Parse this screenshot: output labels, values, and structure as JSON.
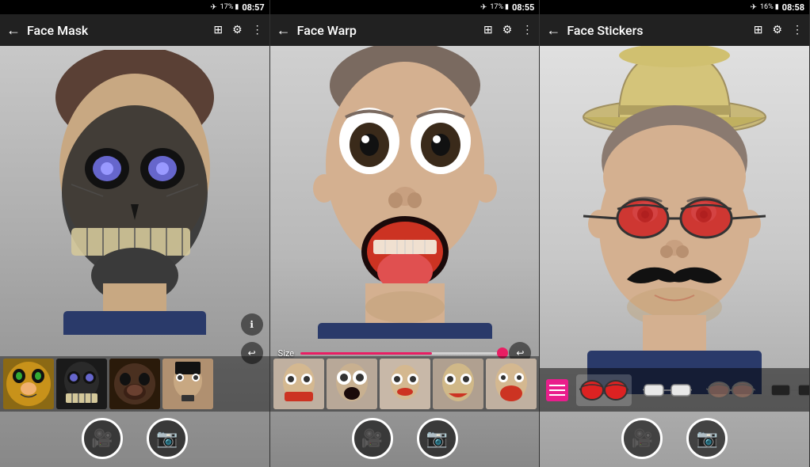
{
  "panels": [
    {
      "id": "face-mask",
      "statusBar": {
        "flight": "✈",
        "battery": "17%",
        "time": "08:57"
      },
      "title": "Face Mask",
      "backLabel": "←",
      "icons": [
        "video-icon",
        "settings-icon",
        "more-icon"
      ],
      "overlayIcons": [
        "info-icon",
        "undo-icon"
      ],
      "sizeLabel": "",
      "thumbnails": [
        {
          "label": "jaguar",
          "color": "#b8860b"
        },
        {
          "label": "skull",
          "color": "#222"
        },
        {
          "label": "gorilla",
          "color": "#3a2010"
        },
        {
          "label": "lincoln",
          "color": "#c8a882"
        }
      ],
      "controls": [
        "video-button",
        "camera-button"
      ]
    },
    {
      "id": "face-warp",
      "statusBar": {
        "flight": "✈",
        "battery": "17%",
        "time": "08:55"
      },
      "title": "Face Warp",
      "backLabel": "←",
      "icons": [
        "video-icon",
        "settings-icon",
        "more-icon"
      ],
      "sizeLabel": "Size",
      "thumbnails": [
        {
          "label": "warp1",
          "color": "#c0b0a0"
        },
        {
          "label": "warp2",
          "color": "#b8a898"
        },
        {
          "label": "warp3",
          "color": "#c8b8a8"
        },
        {
          "label": "warp4",
          "color": "#b0a090"
        },
        {
          "label": "warp5",
          "color": "#c0b0a0"
        }
      ],
      "controls": [
        "video-button",
        "camera-button"
      ]
    },
    {
      "id": "face-stickers",
      "statusBar": {
        "flight": "✈",
        "battery": "16%",
        "time": "08:58"
      },
      "title": "Face Stickers",
      "backLabel": "←",
      "icons": [
        "video-icon",
        "settings-icon",
        "more-icon"
      ],
      "sizeLabel": "",
      "stickerStrip": {
        "menuLabel": "≡",
        "items": [
          {
            "label": "red-glasses",
            "selected": true
          },
          {
            "label": "white-sunglasses"
          },
          {
            "label": "aviator-glasses"
          },
          {
            "label": "dark-glasses"
          }
        ]
      },
      "controls": [
        "video-button",
        "camera-button"
      ]
    }
  ]
}
